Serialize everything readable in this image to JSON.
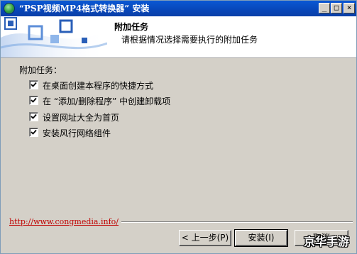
{
  "window": {
    "title": "“PSP视频MP4格式转换器” 安装",
    "controls": {
      "minimize": "_",
      "maximize": "□",
      "close": "×"
    }
  },
  "header": {
    "title": "附加任务",
    "subtitle": "请根据情况选择需要执行的附加任务"
  },
  "tasks": {
    "group_label": "附加任务：",
    "items": [
      {
        "label": "在桌面创建本程序的快捷方式",
        "checked": true
      },
      {
        "label": "在 “添加/删除程序” 中创建卸载项",
        "checked": true
      },
      {
        "label": "设置网址大全为首页",
        "checked": true
      },
      {
        "label": "安装风行网络组件",
        "checked": true
      }
    ]
  },
  "footer": {
    "link": "http://www.congmedia.info/",
    "back_button": "< 上一步(P)",
    "install_button": "安装(I)",
    "cancel_button": "取消"
  },
  "watermark": {
    "text": "京华手游"
  },
  "colors": {
    "titlebar": "#0a58d4",
    "link": "#c00000",
    "face": "#d4d0c8"
  }
}
